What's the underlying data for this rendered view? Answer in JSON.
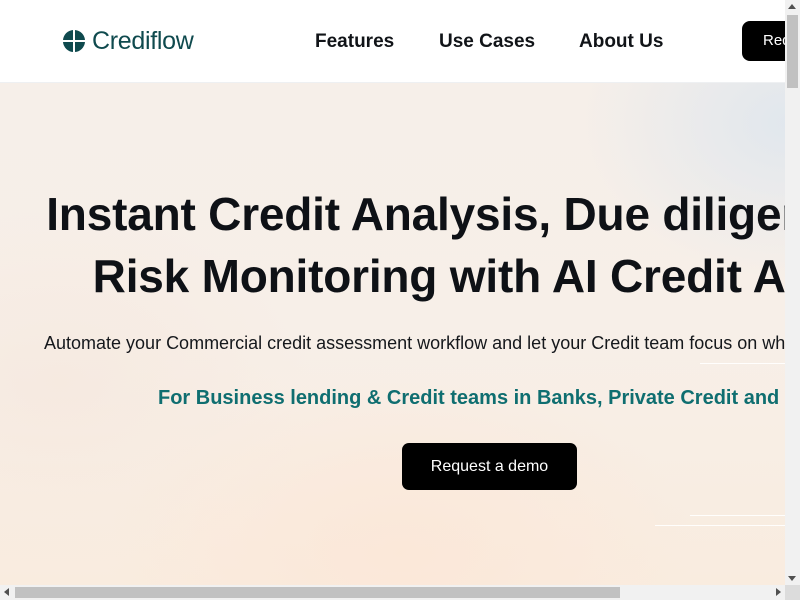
{
  "brand": {
    "name": "Crediflow",
    "logo_icon": "crediflow-leaf-logo",
    "color": "#0f4a4e"
  },
  "nav": {
    "items": [
      {
        "label": "Features"
      },
      {
        "label": "Use Cases"
      },
      {
        "label": "About Us"
      }
    ],
    "cta_label": "Request a demo"
  },
  "hero": {
    "title_line1": "Instant Credit Analysis, Due diligence and",
    "title_line2": "Risk Monitoring with AI Credit Agents",
    "subtitle": "Automate your Commercial credit assessment workflow and let your Credit team focus on what matters",
    "audience": "For Business lending & Credit teams in Banks, Private Credit and Fintechs",
    "cta_label": "Request a demo",
    "accent_color": "#0f6e70"
  },
  "scrollbars": {
    "vertical_position": 0,
    "horizontal_position": 0
  }
}
